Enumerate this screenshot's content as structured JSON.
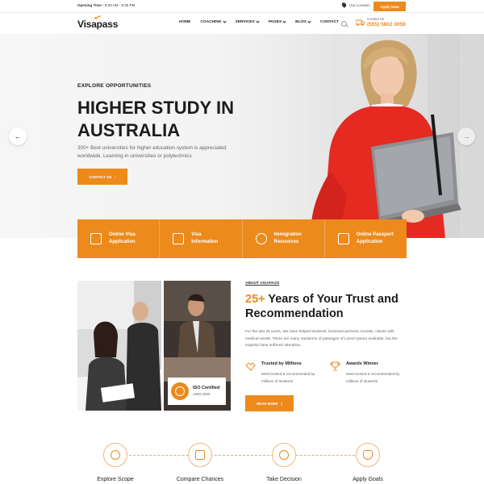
{
  "topbar": {
    "opening_label": "Opening Time :",
    "opening_hours": "8:30 AM - 9:30 PM",
    "location": "Our Location",
    "apply_button": "Apply Now"
  },
  "header": {
    "logo": "Visapass",
    "nav": [
      {
        "label": "HOME",
        "dropdown": false
      },
      {
        "label": "COACHING",
        "dropdown": true
      },
      {
        "label": "SERVICES",
        "dropdown": true
      },
      {
        "label": "PAGES",
        "dropdown": true
      },
      {
        "label": "BLOG",
        "dropdown": true
      },
      {
        "label": "CONTACT",
        "dropdown": false
      }
    ],
    "contact_label": "Contact Us",
    "contact_phone": "(555) 5802 3059"
  },
  "hero": {
    "kicker": "EXPLORE OPPORTUNITIES",
    "title": "HIGHER STUDY IN AUSTRALIA",
    "description": "300+ Best universities for higher education system is appreciated worldwide. Learning in universities or polytechnics",
    "cta": "CONTACT US",
    "prev_arrow": "←",
    "next_arrow": "→"
  },
  "services": [
    {
      "icon": "passport-icon",
      "label": "Online Visa\nApplication"
    },
    {
      "icon": "document-icon",
      "label": "Visa\nInformation"
    },
    {
      "icon": "people-icon",
      "label": "Immigration\nResources"
    },
    {
      "icon": "id-card-icon",
      "label": "Online Passport\nApplication"
    }
  ],
  "about": {
    "kicker": "ABOUT VISAPASS",
    "title_accent": "25+",
    "title_rest": " Years of Your Trust and Recommendation",
    "description": "For the last 25 years, We have helped students, business persons, tourists, clients with medical needs. There are many variations of passages of Lorem Ipsum available, but the majority have suffered alteration.",
    "features": [
      {
        "icon": "handshake-icon",
        "title": "Trusted by Millions",
        "desc": "Most trusted & recommended by millions of students"
      },
      {
        "icon": "trophy-icon",
        "title": "Awards Winner",
        "desc": "Most trusted & recommended by millions of students"
      }
    ],
    "button": "READ MORE",
    "iso_title": "ISO Certified",
    "iso_years": "1990-2000"
  },
  "process": [
    {
      "icon": "compass-icon",
      "label": "Explore Scope"
    },
    {
      "icon": "compare-icon",
      "label": "Compare Chances"
    },
    {
      "icon": "target-icon",
      "label": "Take Decision"
    },
    {
      "icon": "hand-icon",
      "label": "Apply Goals"
    }
  ],
  "colors": {
    "accent": "#ec8a1c",
    "dark": "#1b1b1b"
  }
}
